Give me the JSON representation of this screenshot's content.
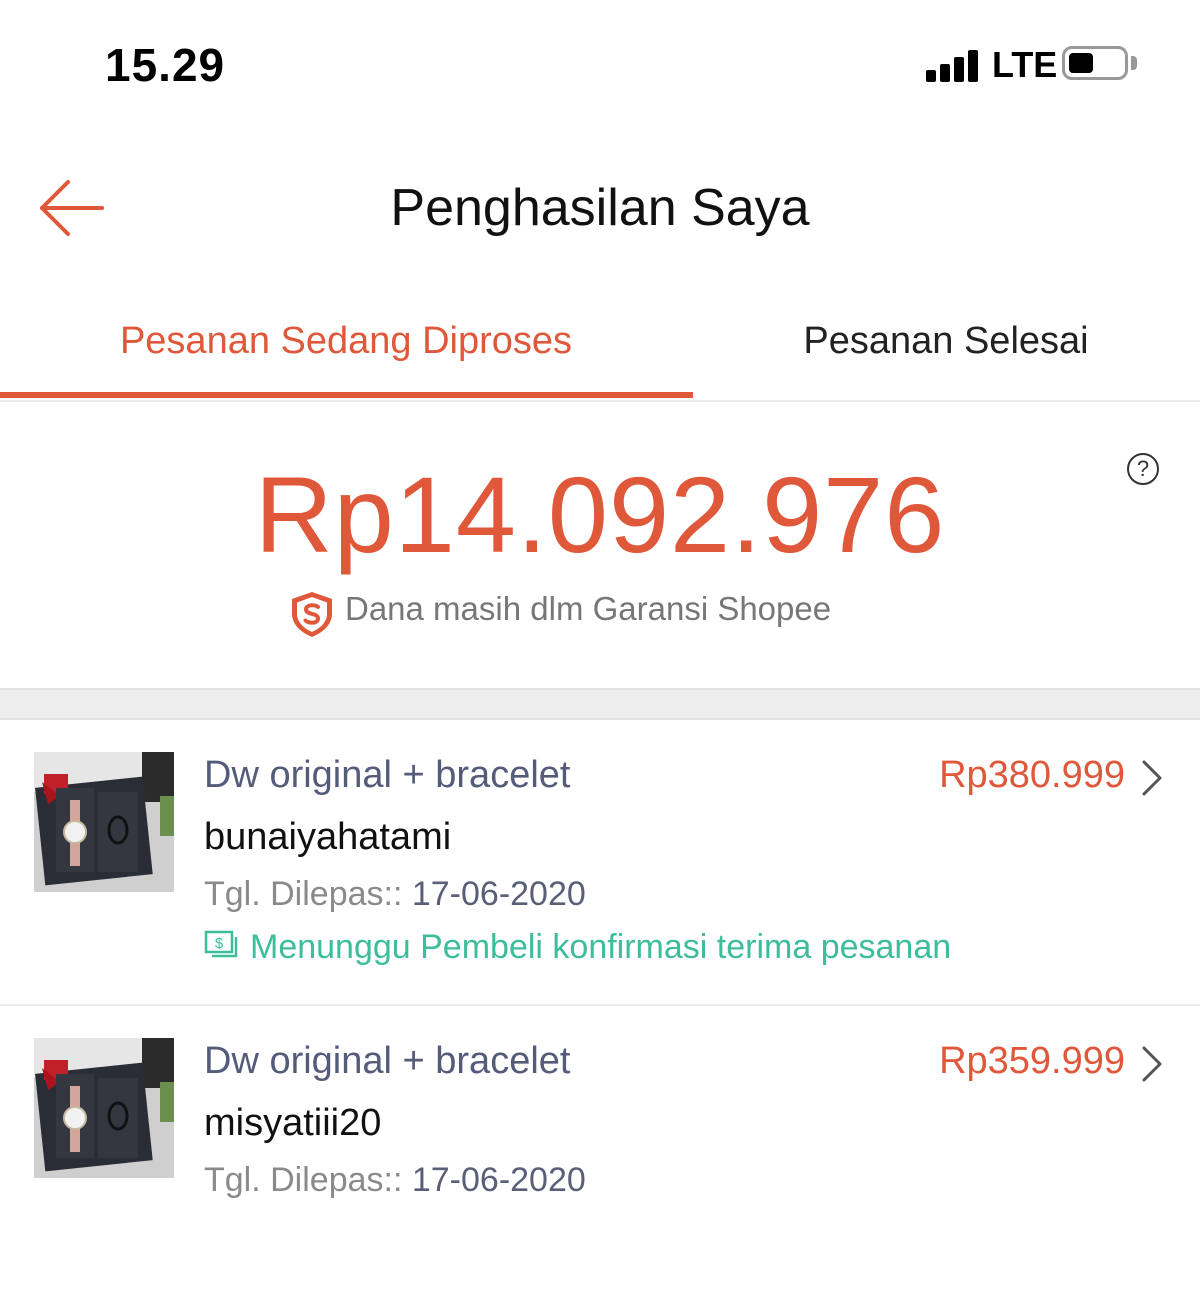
{
  "status_bar": {
    "time": "15.29",
    "network": "LTE"
  },
  "header": {
    "title": "Penghasilan Saya"
  },
  "tabs": [
    {
      "label": "Pesanan Sedang Diproses",
      "active": true
    },
    {
      "label": "Pesanan Selesai",
      "active": false
    }
  ],
  "summary": {
    "amount": "Rp14.092.976",
    "guarantee_text": "Dana masih dlm Garansi Shopee",
    "help": "?"
  },
  "orders": [
    {
      "product": "Dw original + bracelet",
      "price": "Rp380.999",
      "buyer": "bunaiyahatami",
      "date_label": "Tgl. Dilepas::",
      "date": "17-06-2020",
      "status": "Menunggu Pembeli konfirmasi terima pesanan"
    },
    {
      "product": "Dw original + bracelet",
      "price": "Rp359.999",
      "buyer": "misyatiii20",
      "date_label": "Tgl. Dilepas::",
      "date": "17-06-2020"
    }
  ],
  "colors": {
    "accent": "#e0583a",
    "status_green": "#3ebd9d",
    "product_text": "#545c7a"
  },
  "icons": {
    "back": "arrow-left-icon",
    "help": "question-circle-icon",
    "guarantee": "shopee-guarantee-shield-icon",
    "status": "money-icon",
    "chevron": "chevron-right-icon"
  }
}
